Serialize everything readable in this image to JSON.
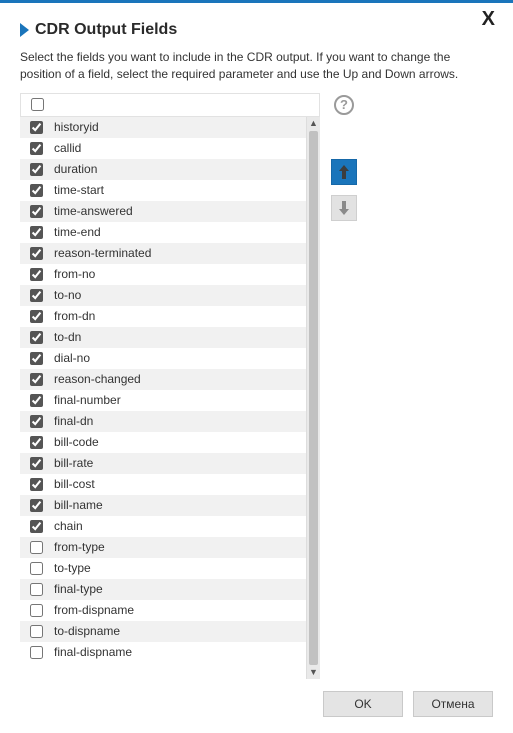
{
  "dialog": {
    "title": "CDR Output Fields",
    "description": "Select the fields you want to include in the CDR output. If you want to change the position of a field, select the required parameter and use the Up and Down arrows.",
    "select_all_checked": false
  },
  "fields": [
    {
      "name": "historyid",
      "checked": true
    },
    {
      "name": "callid",
      "checked": true
    },
    {
      "name": "duration",
      "checked": true
    },
    {
      "name": "time-start",
      "checked": true
    },
    {
      "name": "time-answered",
      "checked": true
    },
    {
      "name": "time-end",
      "checked": true
    },
    {
      "name": "reason-terminated",
      "checked": true
    },
    {
      "name": "from-no",
      "checked": true
    },
    {
      "name": "to-no",
      "checked": true
    },
    {
      "name": "from-dn",
      "checked": true
    },
    {
      "name": "to-dn",
      "checked": true
    },
    {
      "name": "dial-no",
      "checked": true
    },
    {
      "name": "reason-changed",
      "checked": true
    },
    {
      "name": "final-number",
      "checked": true
    },
    {
      "name": "final-dn",
      "checked": true
    },
    {
      "name": "bill-code",
      "checked": true
    },
    {
      "name": "bill-rate",
      "checked": true
    },
    {
      "name": "bill-cost",
      "checked": true
    },
    {
      "name": "bill-name",
      "checked": true
    },
    {
      "name": "chain",
      "checked": true
    },
    {
      "name": "from-type",
      "checked": false
    },
    {
      "name": "to-type",
      "checked": false
    },
    {
      "name": "final-type",
      "checked": false
    },
    {
      "name": "from-dispname",
      "checked": false
    },
    {
      "name": "to-dispname",
      "checked": false
    },
    {
      "name": "final-dispname",
      "checked": false
    }
  ],
  "buttons": {
    "ok": "OK",
    "cancel": "Отмена"
  },
  "icons": {
    "help": "?",
    "close": "X"
  }
}
